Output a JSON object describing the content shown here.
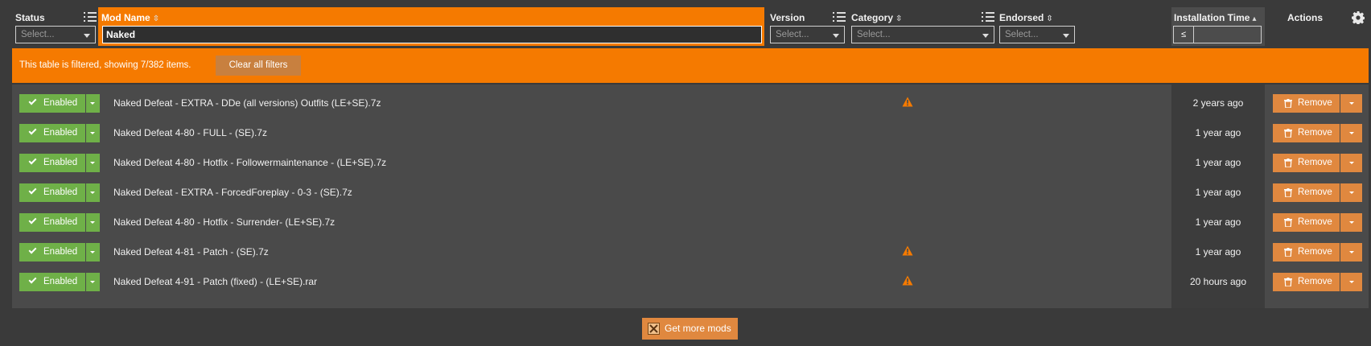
{
  "header": {
    "status": {
      "label": "Status",
      "select_placeholder": "Select..."
    },
    "mod_name": {
      "label": "Mod Name",
      "filter_value": "Naked"
    },
    "version": {
      "label": "Version",
      "select_placeholder": "Select..."
    },
    "category": {
      "label": "Category",
      "select_placeholder": "Select..."
    },
    "endorsed": {
      "label": "Endorsed",
      "select_placeholder": "Select..."
    },
    "installation_time": {
      "label": "Installation Time",
      "operator": "≤",
      "value": ""
    },
    "actions": {
      "label": "Actions"
    }
  },
  "filter_bar": {
    "message": "This table is filtered, showing 7/382 items.",
    "clear_label": "Clear all filters"
  },
  "rows": [
    {
      "status": "Enabled",
      "name": "Naked Defeat - EXTRA - DDe (all versions) Outfits (LE+SE).7z",
      "warning": true,
      "install_time": "2 years ago",
      "action": "Remove"
    },
    {
      "status": "Enabled",
      "name": "Naked Defeat 4-80 - FULL - (SE).7z",
      "warning": false,
      "install_time": "1 year ago",
      "action": "Remove"
    },
    {
      "status": "Enabled",
      "name": "Naked Defeat 4-80 - Hotfix - Followermaintenance - (LE+SE).7z",
      "warning": false,
      "install_time": "1 year ago",
      "action": "Remove"
    },
    {
      "status": "Enabled",
      "name": "Naked Defeat - EXTRA - ForcedForeplay - 0-3 - (SE).7z",
      "warning": false,
      "install_time": "1 year ago",
      "action": "Remove"
    },
    {
      "status": "Enabled",
      "name": "Naked Defeat 4-80 - Hotfix - Surrender- (LE+SE).7z",
      "warning": false,
      "install_time": "1 year ago",
      "action": "Remove"
    },
    {
      "status": "Enabled",
      "name": "Naked Defeat 4-81 - Patch - (SE).7z",
      "warning": true,
      "install_time": "1 year ago",
      "action": "Remove"
    },
    {
      "status": "Enabled",
      "name": "Naked Defeat 4-91 - Patch (fixed) - (LE+SE).rar",
      "warning": true,
      "install_time": "20 hours ago",
      "action": "Remove"
    }
  ],
  "footer": {
    "get_more_label": "Get more mods"
  },
  "icons": {
    "list_filter": "list-icon",
    "sort": "sort-icon",
    "warning": "warning-icon",
    "check": "check-icon",
    "trash": "trash-icon",
    "gear": "gear-icon",
    "nexus": "nexus-icon"
  },
  "colors": {
    "accent": "#f57a00",
    "enabled": "#6fb048",
    "remove": "#e0883f",
    "warning": "#f57a00"
  }
}
